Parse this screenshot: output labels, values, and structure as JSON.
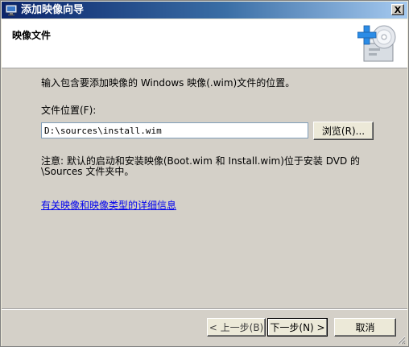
{
  "window": {
    "title": "添加映像向导",
    "close_label": "X"
  },
  "header": {
    "title": "映像文件",
    "graphic_icon": "add-image-disc-icon"
  },
  "main": {
    "instruction": "输入包含要添加映像的 Windows 映像(.wim)文件的位置。",
    "field_label": "文件位置(F):",
    "file_path_value": "D:\\sources\\install.wim",
    "browse_button": "浏览(R)...",
    "note_line1": "注意: 默认的启动和安装映像(Boot.wim 和 Install.wim)位于安装 DVD 的",
    "note_line2": "\\Sources 文件夹中。",
    "info_link": "有关映像和映像类型的详细信息"
  },
  "footer": {
    "back_button": "< 上一步(B)",
    "next_button": "下一步(N) >",
    "cancel_button": "取消"
  },
  "colors": {
    "titlebar_start": "#0a246a",
    "titlebar_end": "#a6caf0",
    "dialog_face": "#d4d0c8",
    "link": "#0000ee",
    "plus_icon": "#2b8ce6"
  }
}
